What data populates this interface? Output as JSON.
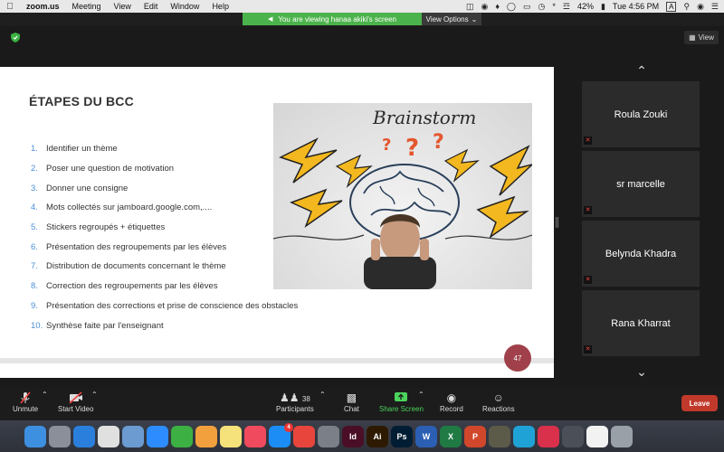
{
  "menubar": {
    "app_name": "zoom.us",
    "items": [
      "Meeting",
      "View",
      "Edit",
      "Window",
      "Help"
    ],
    "battery": "42%",
    "clock": "Tue 4:56 PM",
    "input_source": "A"
  },
  "banner": {
    "text": "You are viewing hanaa akiki's screen",
    "view_options": "View Options"
  },
  "view_button": "View",
  "slide": {
    "title": "ÉTAPES DU BCC",
    "picture_text": "Brainstorm",
    "page_number": "47",
    "steps": [
      {
        "num": "1.",
        "text": "Identifier un thème"
      },
      {
        "num": "2.",
        "text": "Poser une question de motivation"
      },
      {
        "num": "3.",
        "text": "Donner une consigne"
      },
      {
        "num": "4.",
        "text": "Mots collectés sur jamboard.google.com,...."
      },
      {
        "num": "5.",
        "text": "Stickers regroupés + étiquettes"
      },
      {
        "num": "6.",
        "text": "Présentation des regroupements par les élèves"
      },
      {
        "num": "7.",
        "text": "Distribution de documents concernant le thème"
      },
      {
        "num": "8.",
        "text": "Correction des regroupements par les élèves"
      },
      {
        "num": "9.",
        "text": "Présentation des corrections et prise de conscience des obstacles"
      },
      {
        "num": "10.",
        "text": "Synthèse faite par l'enseignant"
      }
    ]
  },
  "participants": [
    {
      "name": "Roula Zouki"
    },
    {
      "name": "sr marcelle"
    },
    {
      "name": "Belynda Khadra"
    },
    {
      "name": "Rana Kharrat"
    }
  ],
  "toolbar": {
    "unmute": "Unmute",
    "start_video": "Start Video",
    "participants_label": "Participants",
    "participants_count": "38",
    "chat": "Chat",
    "share_screen": "Share Screen",
    "record": "Record",
    "reactions": "Reactions",
    "leave": "Leave"
  },
  "dock": {
    "mail_badge": "4",
    "apps": [
      {
        "name": "finder-icon",
        "color": "#3d8fe0",
        "label": ""
      },
      {
        "name": "launchpad-icon",
        "color": "#8a8f99",
        "label": ""
      },
      {
        "name": "safari-icon",
        "color": "#2a7fdc",
        "label": ""
      },
      {
        "name": "chrome-icon",
        "color": "#e0e0e0",
        "label": ""
      },
      {
        "name": "preview-icon",
        "color": "#6b9bd1",
        "label": ""
      },
      {
        "name": "zoom-icon",
        "color": "#2d8cff",
        "label": ""
      },
      {
        "name": "facetime-icon",
        "color": "#3cb043",
        "label": ""
      },
      {
        "name": "photos-icon",
        "color": "#f2a03d",
        "label": ""
      },
      {
        "name": "notes-icon",
        "color": "#f6e27a",
        "label": ""
      },
      {
        "name": "music-icon",
        "color": "#f04a5e",
        "label": ""
      },
      {
        "name": "appstore-icon",
        "color": "#1c8df5",
        "label": ""
      },
      {
        "name": "anydesk-icon",
        "color": "#e8453c",
        "label": ""
      },
      {
        "name": "systemprefs-icon",
        "color": "#7b7f87",
        "label": ""
      },
      {
        "name": "indesign-icon",
        "color": "#4a0f26",
        "label": "Id"
      },
      {
        "name": "illustrator-icon",
        "color": "#2e1a00",
        "label": "Ai"
      },
      {
        "name": "photoshop-icon",
        "color": "#001d34",
        "label": "Ps"
      },
      {
        "name": "word-icon",
        "color": "#2b5fb4",
        "label": "W"
      },
      {
        "name": "excel-icon",
        "color": "#1f7a43",
        "label": "X"
      },
      {
        "name": "powerpoint-icon",
        "color": "#d0472b",
        "label": "P"
      },
      {
        "name": "game-icon",
        "color": "#5c5a48",
        "label": ""
      },
      {
        "name": "accessibility-icon",
        "color": "#1fa3d6",
        "label": ""
      },
      {
        "name": "creative-cloud-icon",
        "color": "#d9304b",
        "label": ""
      },
      {
        "name": "quicktime-icon",
        "color": "#4a4f58",
        "label": ""
      },
      {
        "name": "textedit-icon",
        "color": "#f2f2f2",
        "label": ""
      },
      {
        "name": "trash-icon",
        "color": "#9aa0a8",
        "label": ""
      }
    ]
  }
}
